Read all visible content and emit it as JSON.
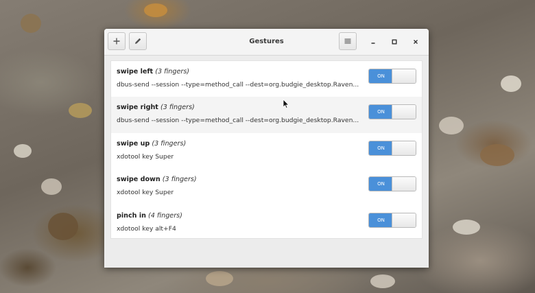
{
  "window": {
    "title": "Gestures",
    "add_icon": "plus-icon",
    "edit_icon": "pencil-icon",
    "menu_icon": "hamburger-menu-icon",
    "minimize_icon": "minimize-icon",
    "maximize_icon": "maximize-icon",
    "close_icon": "close-icon"
  },
  "gestures": [
    {
      "name": "swipe left",
      "fingers": "(3 fingers)",
      "command": "dbus-send --session --type=method_call --dest=org.budgie_desktop.Raven...",
      "toggle": "ON"
    },
    {
      "name": "swipe right",
      "fingers": "(3 fingers)",
      "command": "dbus-send --session --type=method_call --dest=org.budgie_desktop.Raven...",
      "toggle": "ON"
    },
    {
      "name": "swipe up",
      "fingers": "(3 fingers)",
      "command": "xdotool key Super",
      "toggle": "ON"
    },
    {
      "name": "swipe down",
      "fingers": "(3 fingers)",
      "command": "xdotool key Super",
      "toggle": "ON"
    },
    {
      "name": "pinch in",
      "fingers": "(4 fingers)",
      "command": "xdotool key alt+F4",
      "toggle": "ON"
    }
  ],
  "colors": {
    "accent": "#4a90d9",
    "window_bg": "#ececec",
    "list_bg": "#ffffff"
  }
}
